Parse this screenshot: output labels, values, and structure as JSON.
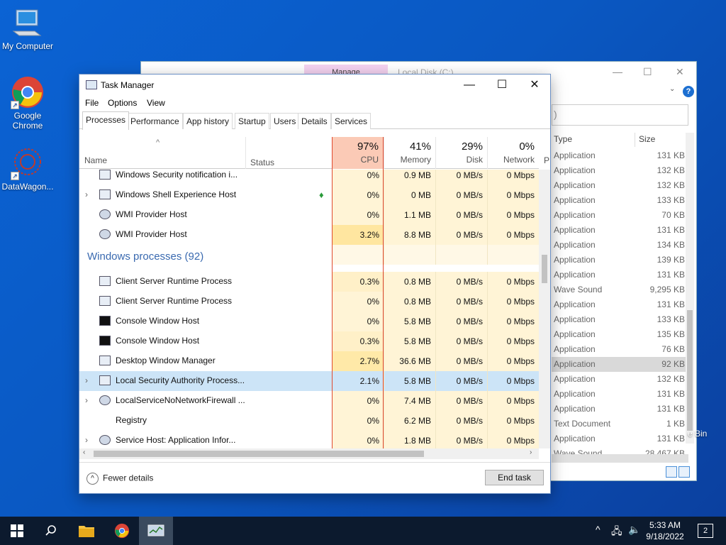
{
  "desktop": {
    "icons": [
      {
        "label": "My Computer"
      },
      {
        "label": "Google Chrome"
      },
      {
        "label": "DataWagon..."
      }
    ],
    "recycle_label": "e Bin"
  },
  "explorer": {
    "manage_label": "Manage",
    "path_text": "Local Disk (C:)",
    "search_text": ")",
    "help_label": "?",
    "columns": {
      "type": "Type",
      "size": "Size"
    },
    "rows": [
      {
        "type": "Application",
        "size": "131 KB"
      },
      {
        "type": "Application",
        "size": "132 KB"
      },
      {
        "type": "Application",
        "size": "132 KB"
      },
      {
        "type": "Application",
        "size": "133 KB"
      },
      {
        "type": "Application",
        "size": "70 KB"
      },
      {
        "type": "Application",
        "size": "131 KB"
      },
      {
        "type": "Application",
        "size": "134 KB"
      },
      {
        "type": "Application",
        "size": "139 KB"
      },
      {
        "type": "Application",
        "size": "131 KB"
      },
      {
        "type": "Wave Sound",
        "size": "9,295 KB"
      },
      {
        "type": "Application",
        "size": "131 KB"
      },
      {
        "type": "Application",
        "size": "133 KB"
      },
      {
        "type": "Application",
        "size": "135 KB"
      },
      {
        "type": "Application",
        "size": "76 KB"
      },
      {
        "type": "Application",
        "size": "92 KB"
      },
      {
        "type": "Application",
        "size": "132 KB"
      },
      {
        "type": "Application",
        "size": "131 KB"
      },
      {
        "type": "Application",
        "size": "131 KB"
      },
      {
        "type": "Text Document",
        "size": "1 KB"
      },
      {
        "type": "Application",
        "size": "131 KB"
      },
      {
        "type": "Wave Sound",
        "size": "28,467 KB"
      }
    ]
  },
  "taskmanager": {
    "title": "Task Manager",
    "menu": [
      "File",
      "Options",
      "View"
    ],
    "tabs": [
      "Processes",
      "Performance",
      "App history",
      "Startup",
      "Users",
      "Details",
      "Services"
    ],
    "header": {
      "name": "Name",
      "status": "Status",
      "cpu_pct": "97%",
      "cpu_label": "CPU",
      "mem_pct": "41%",
      "mem_label": "Memory",
      "disk_pct": "29%",
      "disk_label": "Disk",
      "net_pct": "0%",
      "net_label": "Network",
      "extra_label": "P"
    },
    "rows": [
      {
        "name": "Windows Security notification i...",
        "cpu": "0%",
        "mem": "0.9 MB",
        "disk": "0 MB/s",
        "net": "0 Mbps"
      },
      {
        "name": "Windows Shell Experience Host",
        "cpu": "0%",
        "mem": "0 MB",
        "disk": "0 MB/s",
        "net": "0 Mbps"
      },
      {
        "name": "WMI Provider Host",
        "cpu": "0%",
        "mem": "1.1 MB",
        "disk": "0 MB/s",
        "net": "0 Mbps"
      },
      {
        "name": "WMI Provider Host",
        "cpu": "3.2%",
        "mem": "8.8 MB",
        "disk": "0 MB/s",
        "net": "0 Mbps"
      }
    ],
    "group_label": "Windows processes (92)",
    "win_rows": [
      {
        "name": "Client Server Runtime Process",
        "cpu": "0.3%",
        "mem": "0.8 MB",
        "disk": "0 MB/s",
        "net": "0 Mbps"
      },
      {
        "name": "Client Server Runtime Process",
        "cpu": "0%",
        "mem": "0.8 MB",
        "disk": "0 MB/s",
        "net": "0 Mbps"
      },
      {
        "name": "Console Window Host",
        "cpu": "0%",
        "mem": "5.8 MB",
        "disk": "0 MB/s",
        "net": "0 Mbps"
      },
      {
        "name": "Console Window Host",
        "cpu": "0.3%",
        "mem": "5.8 MB",
        "disk": "0 MB/s",
        "net": "0 Mbps"
      },
      {
        "name": "Desktop Window Manager",
        "cpu": "2.7%",
        "mem": "36.6 MB",
        "disk": "0 MB/s",
        "net": "0 Mbps"
      },
      {
        "name": "Local Security Authority Process...",
        "cpu": "2.1%",
        "mem": "5.8 MB",
        "disk": "0 MB/s",
        "net": "0 Mbps"
      },
      {
        "name": "LocalServiceNoNetworkFirewall ...",
        "cpu": "0%",
        "mem": "7.4 MB",
        "disk": "0 MB/s",
        "net": "0 Mbps"
      },
      {
        "name": "Registry",
        "cpu": "0%",
        "mem": "6.2 MB",
        "disk": "0 MB/s",
        "net": "0 Mbps"
      },
      {
        "name": "Service Host: Application Infor...",
        "cpu": "0%",
        "mem": "1.8 MB",
        "disk": "0 MB/s",
        "net": "0 Mbps"
      }
    ],
    "fewer_details": "Fewer details",
    "end_task": "End task"
  },
  "taskbar": {
    "time": "5:33 AM",
    "date": "9/18/2022",
    "notif_count": "2"
  }
}
